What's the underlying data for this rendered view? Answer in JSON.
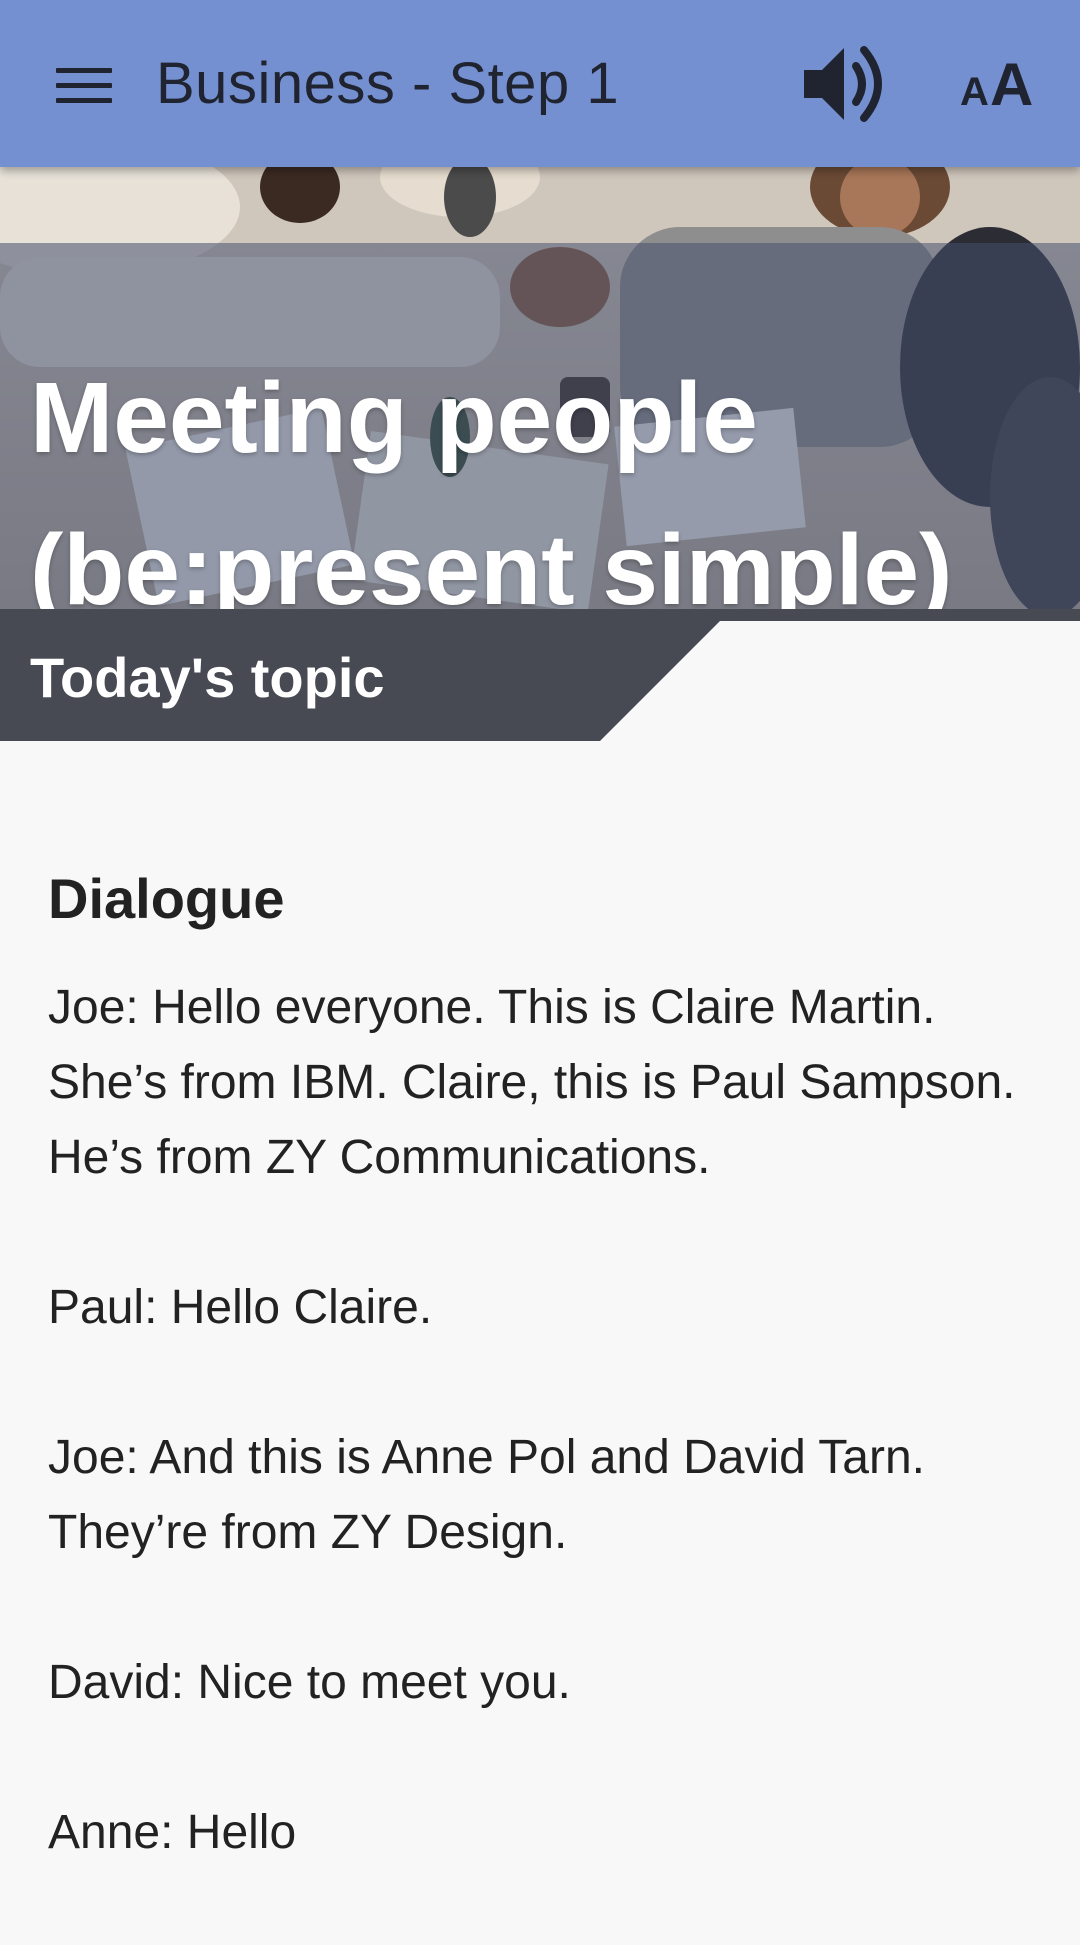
{
  "appbar": {
    "title": "Business - Step 1",
    "background": "#7590d1",
    "icons": {
      "menu": "menu-icon",
      "audio": "speaker-icon",
      "text_size": "font-size-icon"
    },
    "text_size_small": "A",
    "text_size_large": "A"
  },
  "hero": {
    "title": "Meeting people (be:present simple)"
  },
  "topic_banner": {
    "label": "Today's topic",
    "color": "#474a52"
  },
  "content": {
    "heading": "Dialogue",
    "lines": [
      "Joe: Hello everyone. This is Claire Martin. She’s from IBM. Claire, this is Paul Sampson. He’s from ZY Communications.",
      "Paul: Hello Claire.",
      "Joe: And this is Anne Pol and David Tarn. They’re from ZY Design.",
      "David: Nice to meet you.",
      "Anne: Hello"
    ]
  }
}
